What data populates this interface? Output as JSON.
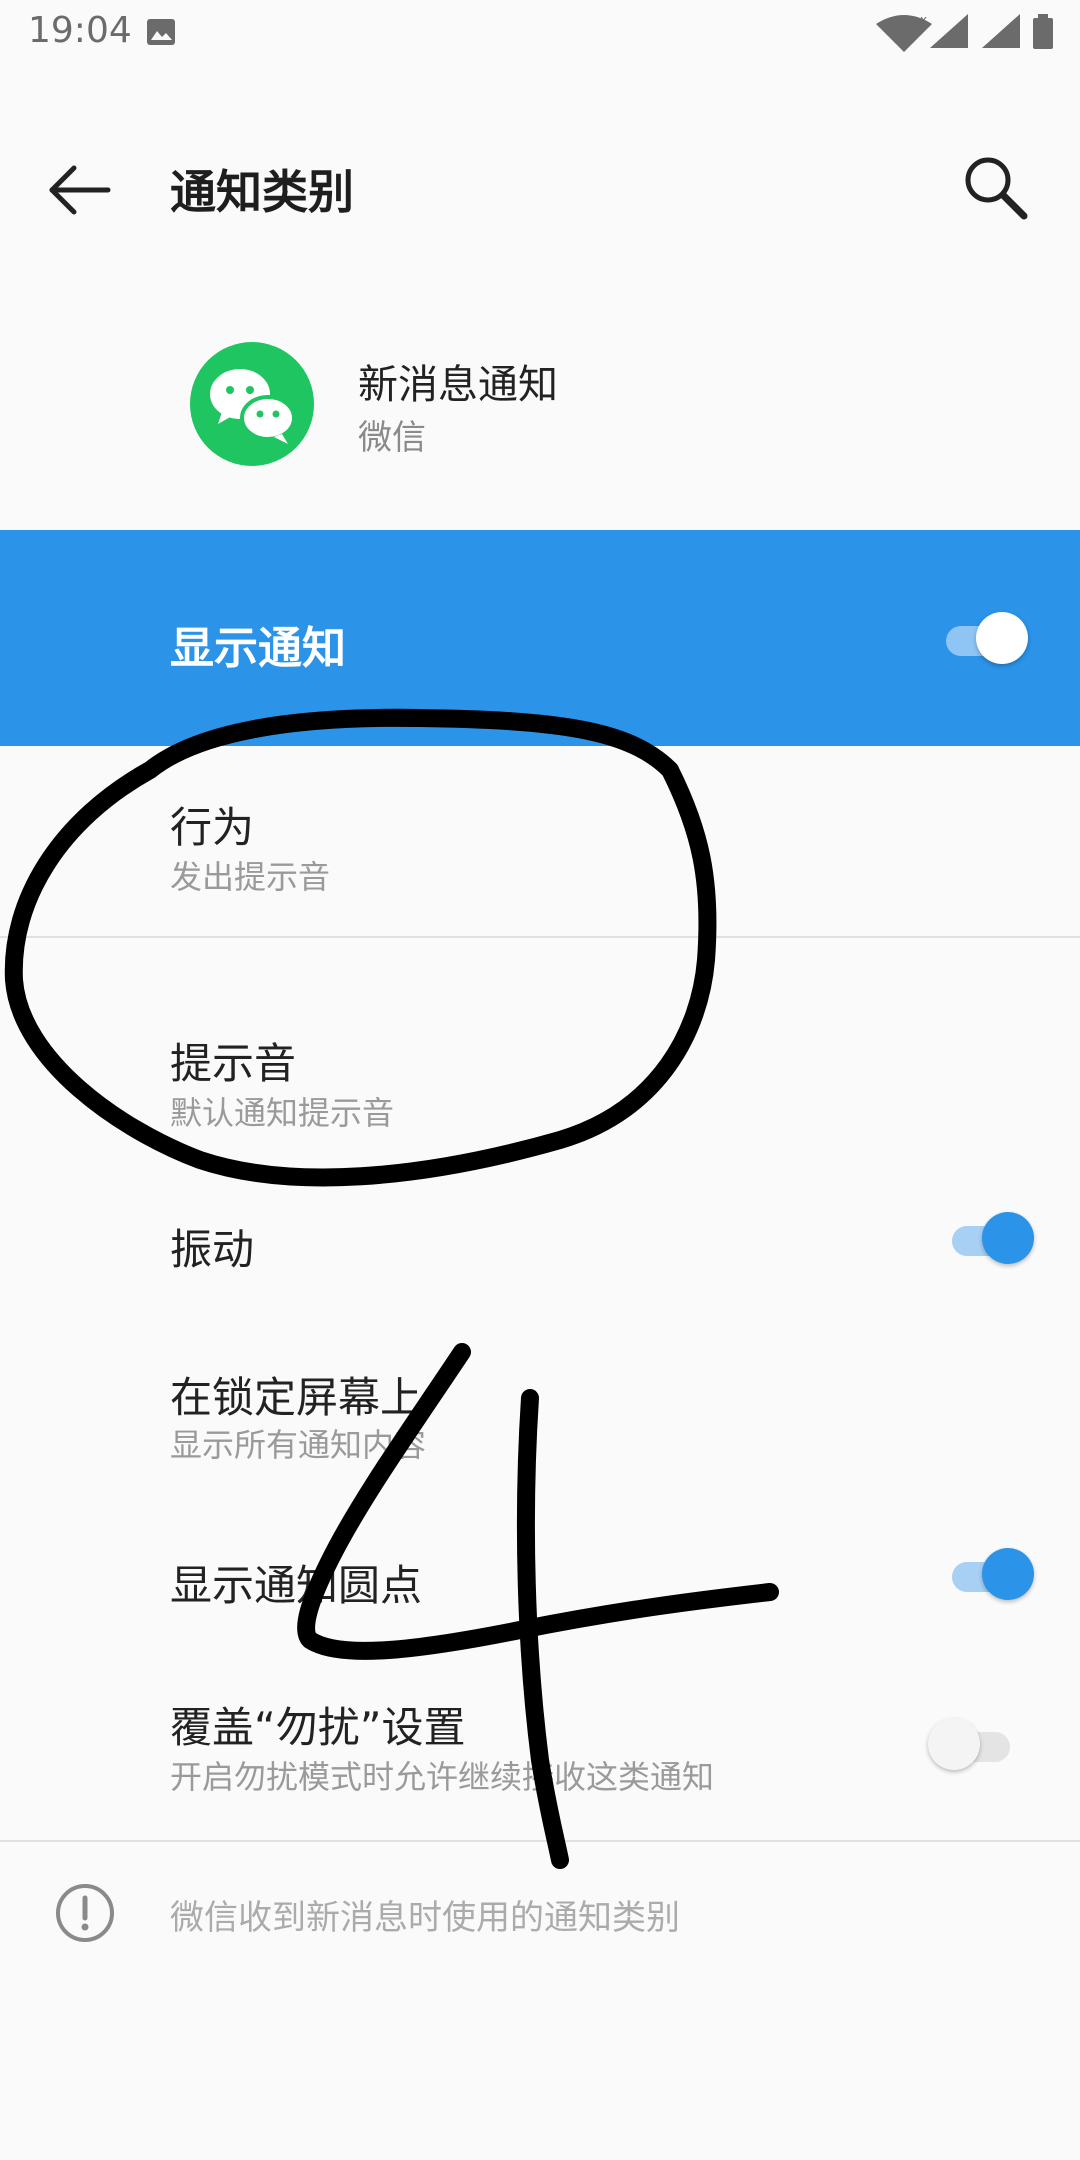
{
  "status_bar": {
    "time": "19:04",
    "signal_x": "x"
  },
  "app_bar": {
    "title": "通知类别"
  },
  "header": {
    "title": "新消息通知",
    "subtitle": "微信"
  },
  "main_switch": {
    "label": "显示通知",
    "on": true
  },
  "settings": [
    {
      "title": "行为",
      "summary": "发出提示音"
    },
    {
      "title": "提示音",
      "summary": "默认通知提示音"
    },
    {
      "title": "振动",
      "toggle": true
    },
    {
      "title": "在锁定屏幕上",
      "summary": "显示所有通知内容"
    },
    {
      "title": "显示通知圆点",
      "toggle": true
    },
    {
      "title": "覆盖“勿扰”设置",
      "summary": "开启勿扰模式时允许继续接收这类通知",
      "toggle": false
    }
  ],
  "footer": {
    "text": "微信收到新消息时使用的通知类别"
  },
  "annotation": {
    "number": "4"
  },
  "colors": {
    "accent": "#2b93e8",
    "wechat_green": "#1fc560",
    "background": "#fafafa"
  }
}
